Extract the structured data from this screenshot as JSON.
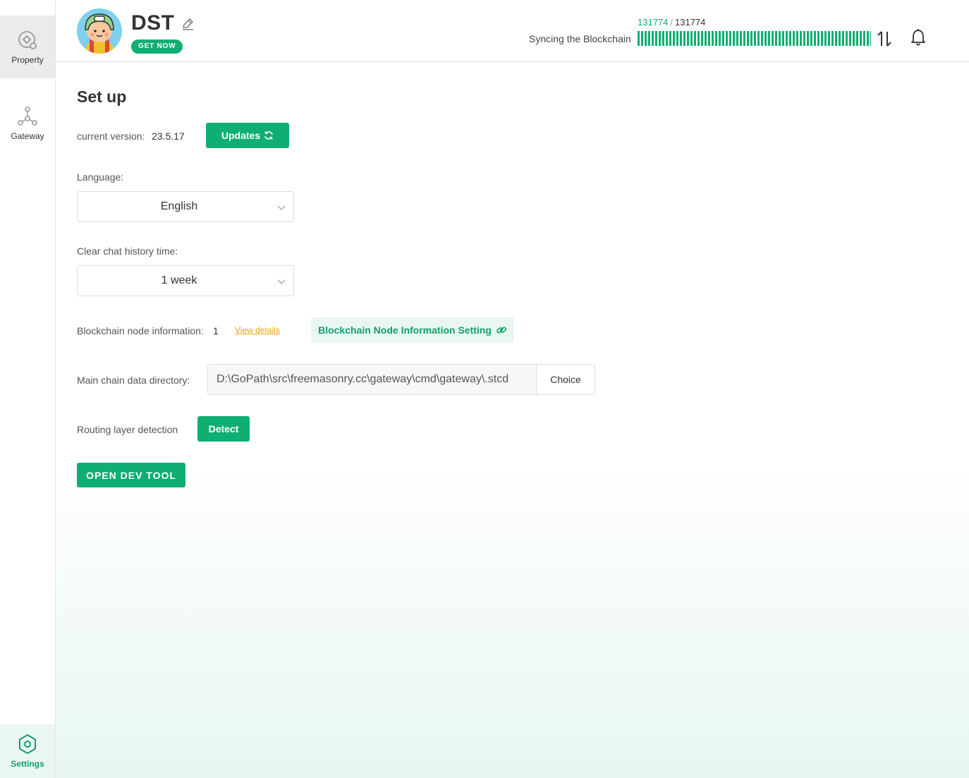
{
  "sidebar": {
    "items": [
      {
        "label": "Property",
        "icon": "property-icon"
      },
      {
        "label": "Gateway",
        "icon": "gateway-icon"
      }
    ],
    "settings": {
      "label": "Settings",
      "icon": "settings-hexagon-icon"
    }
  },
  "header": {
    "title": "DST",
    "get_now": "GET NOW",
    "sync": {
      "current": "131774",
      "separator": "/",
      "total": "131774",
      "label": "Syncing the Blockchain",
      "progress": 1.0
    }
  },
  "main": {
    "title": "Set up",
    "version": {
      "label": "current version:",
      "value": "23.5.17",
      "button": "Updates"
    },
    "language": {
      "label": "Language:",
      "selected": "English"
    },
    "chat_history": {
      "label": "Clear chat history time:",
      "selected": "1 week"
    },
    "node_info": {
      "label": "Blockchain node information:",
      "value": "1",
      "view_details": "View details",
      "setting_button": "Blockchain Node Information Setting"
    },
    "data_dir": {
      "label": "Main chain data directory:",
      "value": "D:\\GoPath\\src\\freemasonry.cc\\gateway\\cmd\\gateway\\.stcd",
      "choice_button": "Choice"
    },
    "routing": {
      "label": "Routing layer detection",
      "button": "Detect"
    },
    "dev_tool_button": "OPEN DEV TOOL"
  },
  "colors": {
    "accent": "#0fae72",
    "accent_light": "#eaf7f1",
    "link": "#e8a218"
  }
}
